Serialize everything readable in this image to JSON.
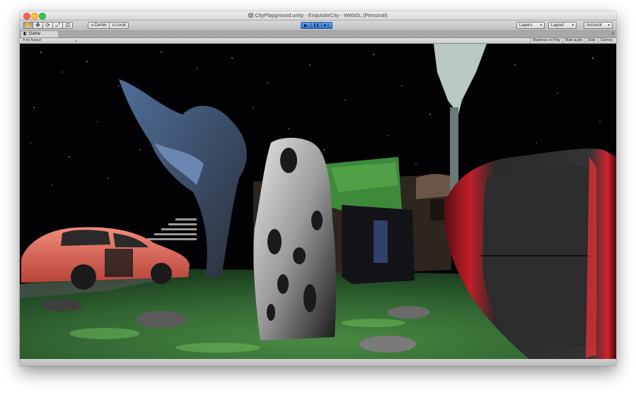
{
  "window": {
    "title": "CityPlayground.unity - ExquisiteCity - WebGL (Personal)",
    "app_icon": "unity-logo-icon"
  },
  "toolbar": {
    "tools": [
      {
        "name": "hand-tool-icon",
        "glyph": "✋"
      },
      {
        "name": "move-tool-icon",
        "glyph": "✥"
      },
      {
        "name": "rotate-tool-icon",
        "glyph": "⟳"
      },
      {
        "name": "scale-tool-icon",
        "glyph": "⤢"
      },
      {
        "name": "rect-tool-icon",
        "glyph": "⊡"
      }
    ],
    "pivot_label": "Center",
    "space_label": "Local",
    "play_glyph": "▶",
    "pause_glyph": "❚❚",
    "step_glyph": "▶❙",
    "layers_label": "Layers",
    "layout_label": "Layout",
    "account_label": "Account",
    "caret": "▾"
  },
  "game_view": {
    "tab_label": "Game",
    "tab_icon": "game-controller-icon",
    "aspect_label": "Free Aspect",
    "caret": "▾",
    "menu_glyph": "≡",
    "options": [
      "Maximize on Play",
      "Mute audio",
      "Stats",
      "Gizmos"
    ]
  },
  "colors": {
    "play_accent": "#2f74cf",
    "sky": "#000000",
    "grass": "#3f7a3b",
    "car": "#d9574a",
    "red_cube": "#c21f2a"
  }
}
